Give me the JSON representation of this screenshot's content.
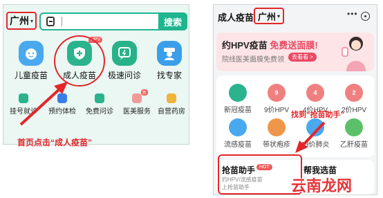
{
  "left": {
    "city": "广州",
    "search_button": "搜索",
    "big_icons": [
      {
        "label": "儿童疫苗",
        "color": "#4aa8ef",
        "icon": "child-face-icon"
      },
      {
        "label": "成人疫苗",
        "color": "#2ab38c",
        "icon": "shield-plus-icon",
        "tag": "HPV"
      },
      {
        "label": "极速问诊",
        "color": "#28b289",
        "icon": "chat-bolt-icon"
      },
      {
        "label": "找专家",
        "color": "#3b9ee8",
        "icon": "doctor-icon"
      }
    ],
    "small_icons": [
      {
        "label": "挂号就诊",
        "color": "#2ab38c",
        "icon": "registration-icon"
      },
      {
        "label": "预约体检",
        "color": "#3b7ee8",
        "icon": "checkup-icon"
      },
      {
        "label": "免费问诊",
        "color": "#2ab38c",
        "icon": "free-consult-icon"
      },
      {
        "label": "医美服务",
        "color": "#f09a9a",
        "icon": "beauty-icon",
        "tag": "新"
      },
      {
        "label": "自营药房",
        "color": "#f0b43c",
        "icon": "pharmacy-icon"
      }
    ],
    "caption": "首页点击“成人疫苗”"
  },
  "right": {
    "title": "成人疫苗",
    "city": "广州",
    "more": "•••",
    "banner": {
      "title_prefix": "约HPV疫苗",
      "title_highlight": "免费送面膜!",
      "subtitle": "院线医美面膜免费领",
      "go": "去看看 >"
    },
    "grid": [
      {
        "label": "新冠疫苗",
        "color": "#2ab38c",
        "badge": ""
      },
      {
        "label": "9价HPV",
        "color": "#f08080",
        "badge": "9"
      },
      {
        "label": "4价HPV",
        "color": "#f08080",
        "badge": "4"
      },
      {
        "label": "2价HPV",
        "color": "#f08080",
        "badge": "2"
      },
      {
        "label": "流感疫苗",
        "color": "#4aa8ef",
        "badge": ""
      },
      {
        "label": "带状疱疹",
        "color": "#f0964a",
        "badge": ""
      },
      {
        "label": "13价肺炎",
        "color": "#4aa8ef",
        "badge": ""
      },
      {
        "label": "乙肝疫苗",
        "color": "#5cc06a",
        "badge": ""
      }
    ],
    "caption": "找到“抢苗助手”",
    "qiang_title": "抢苗助手",
    "hot": "HOT",
    "qiang_sub": "约HPV/流感疫苗上抢苗助手",
    "help": "帮我选苗"
  },
  "watermark": "云南龙网"
}
